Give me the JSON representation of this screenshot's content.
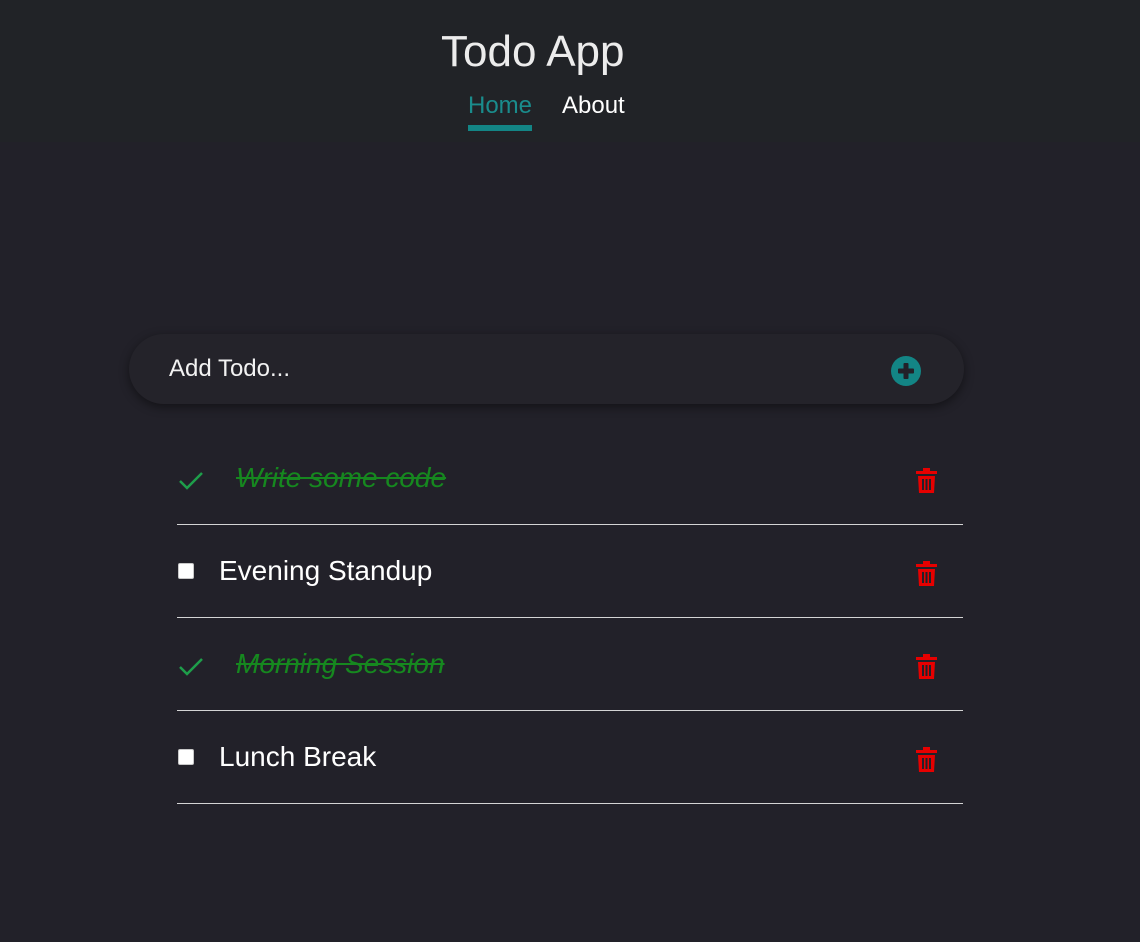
{
  "header": {
    "title": "Todo App",
    "nav": [
      {
        "label": "Home",
        "active": true
      },
      {
        "label": "About",
        "active": false
      }
    ]
  },
  "add_todo": {
    "placeholder": "Add Todo...",
    "value": "",
    "button_icon": "plus-circle-icon"
  },
  "todos": [
    {
      "text": "Write some code",
      "completed": true
    },
    {
      "text": "Evening Standup",
      "completed": false
    },
    {
      "text": "Morning Session",
      "completed": true
    },
    {
      "text": "Lunch Break",
      "completed": false
    }
  ],
  "icons": {
    "completed": "checkmark-icon",
    "delete": "trash-icon",
    "add": "plus-circle-icon"
  },
  "colors": {
    "accent": "#138585",
    "completed_text": "#16881f",
    "delete": "#e60000",
    "background": "#222129",
    "header_background": "#212327"
  }
}
